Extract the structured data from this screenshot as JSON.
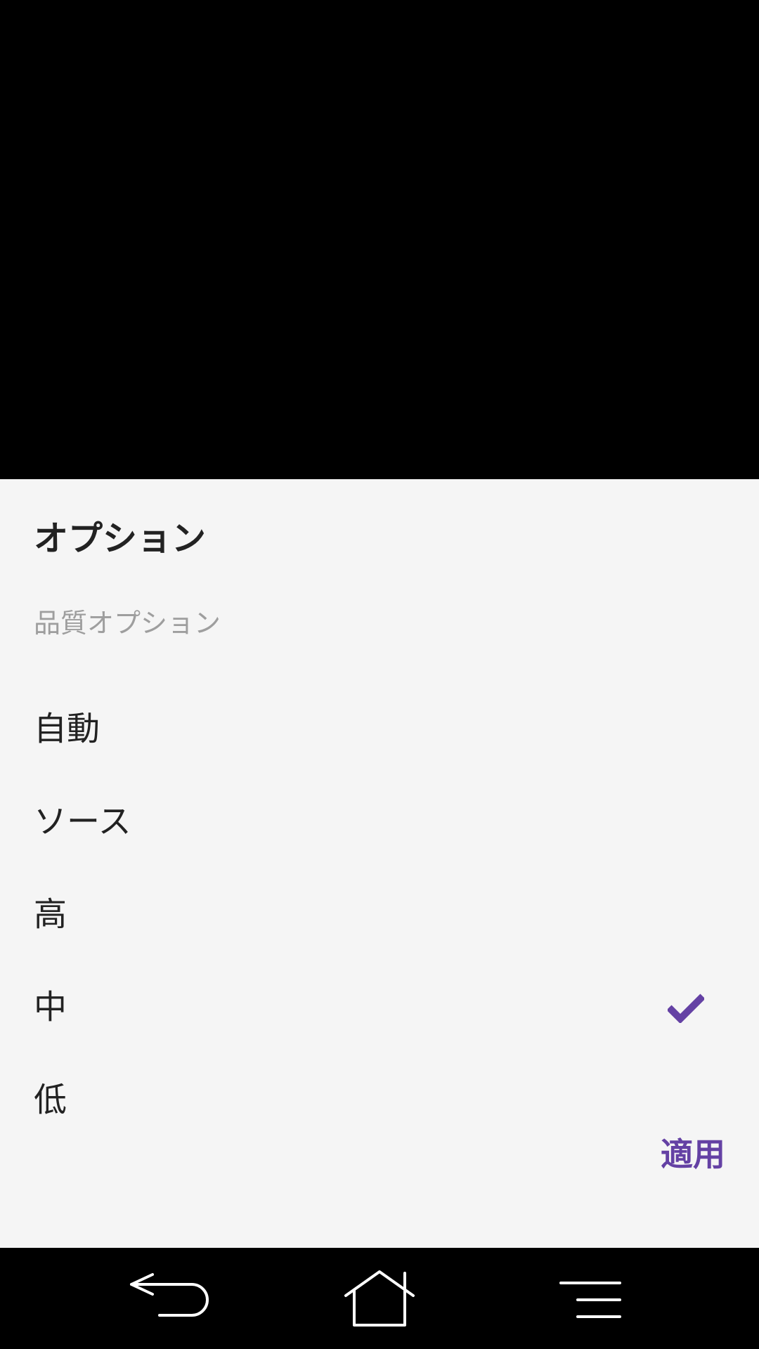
{
  "sheet": {
    "title": "オプション",
    "section_label": "品質オプション",
    "options": [
      {
        "label": "自動",
        "selected": false
      },
      {
        "label": "ソース",
        "selected": false
      },
      {
        "label": "高",
        "selected": false
      },
      {
        "label": "中",
        "selected": true
      },
      {
        "label": "低",
        "selected": false
      }
    ],
    "apply_label": "適用"
  },
  "colors": {
    "accent": "#6441a4",
    "sheet_background": "#f5f5f5",
    "text_primary": "#222222",
    "text_secondary": "#9e9e9e"
  },
  "nav_bar": {
    "icons": [
      "back-icon",
      "home-icon",
      "menu-icon"
    ]
  }
}
